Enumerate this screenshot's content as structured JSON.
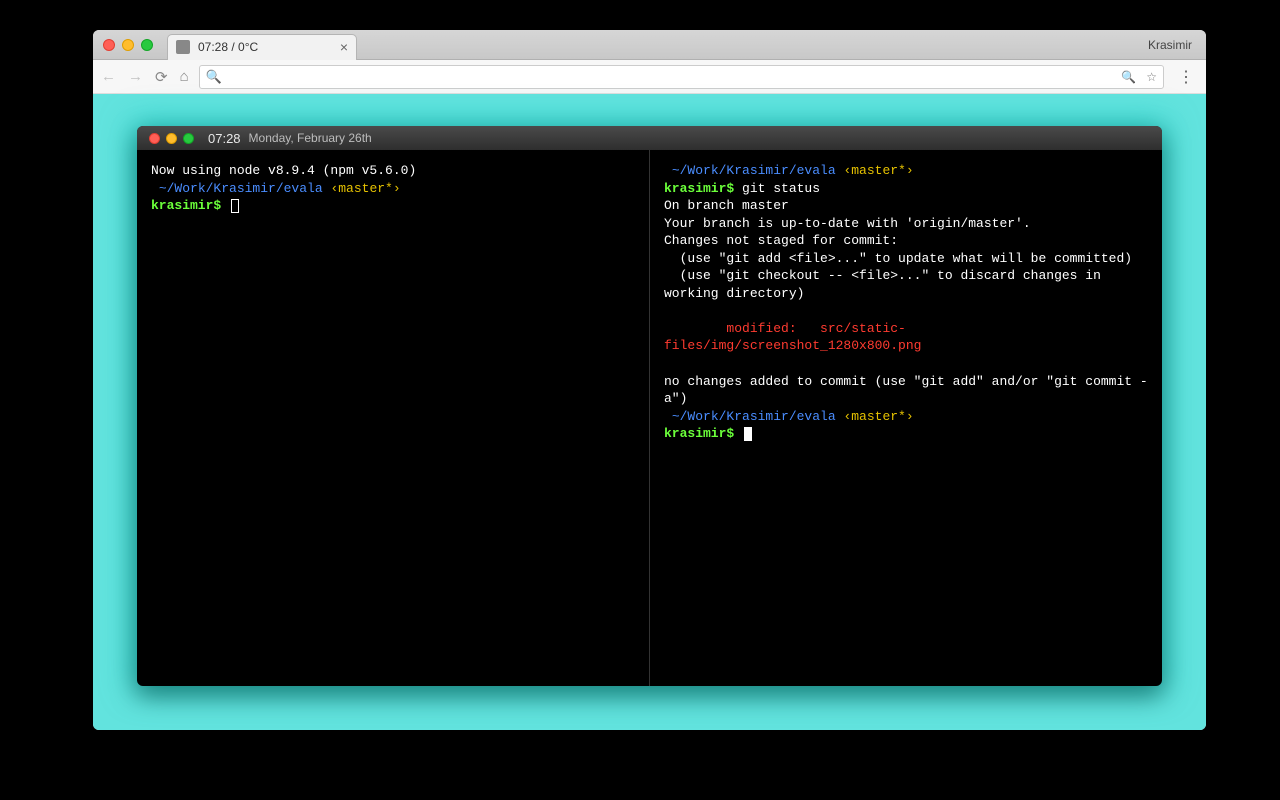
{
  "browser": {
    "tab_title": "07:28 / 0°C",
    "profile_name": "Krasimir",
    "omnibox_value": ""
  },
  "terminal": {
    "titlebar": {
      "time": "07:28",
      "date": "Monday, February 26th"
    },
    "left_pane": {
      "line1": "Now using node v8.9.4 (npm v5.6.0)",
      "path": " ~/Work/Krasimir/evala ",
      "branch": "‹master*›",
      "prompt_user": "krasimir$"
    },
    "right_pane": {
      "path": " ~/Work/Krasimir/evala ",
      "branch": "‹master*›",
      "prompt_user": "krasimir$",
      "cmd1": " git status",
      "out1": "On branch master",
      "out2": "Your branch is up-to-date with 'origin/master'.",
      "out3": "Changes not staged for commit:",
      "out4": "  (use \"git add <file>...\" to update what will be committed)",
      "out5": "  (use \"git checkout -- <file>...\" to discard changes in working directory)",
      "modified": "        modified:   src/static-files/img/screenshot_1280x800.png",
      "out6": "no changes added to commit (use \"git add\" and/or \"git commit -a\")",
      "path2": " ~/Work/Krasimir/evala ",
      "branch2": "‹master*›",
      "prompt_user2": "krasimir$"
    }
  },
  "colors": {
    "page_bg": "#62e3de",
    "term_bg": "#000000",
    "blue": "#4a8dff",
    "yellow": "#e5c100",
    "green": "#6bff3a",
    "red": "#ff3b30"
  }
}
